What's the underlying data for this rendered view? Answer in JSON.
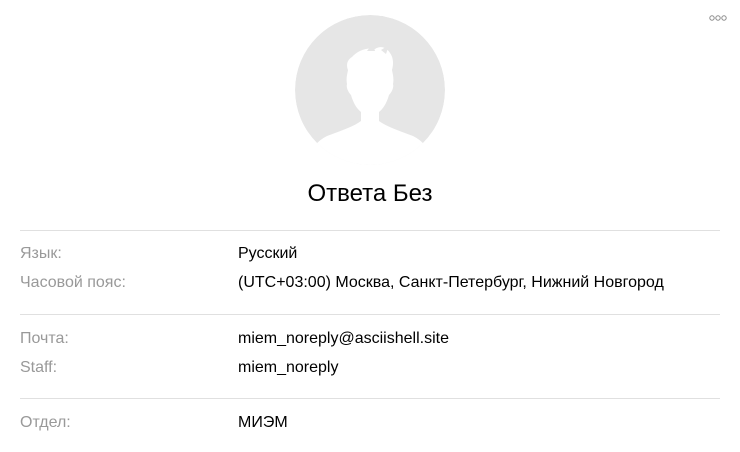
{
  "header": {
    "more_icon": "ellipsis-horizontal-icon"
  },
  "avatar": {
    "icon": "user-silhouette-icon",
    "background_color": "#e6e6e6",
    "silhouette_color": "#ffffff"
  },
  "profile": {
    "name": "Ответа Без"
  },
  "sections": {
    "locale": {
      "language_label": "Язык:",
      "language_value": "Русский",
      "timezone_label": "Часовой пояс:",
      "timezone_value": "(UTC+03:00) Москва, Санкт-Петербург, Нижний Новгород"
    },
    "contacts": {
      "email_label": "Почта:",
      "email_value": "miem_noreply@asciishell.site",
      "staff_label": "Staff:",
      "staff_value": "miem_noreply"
    },
    "department": {
      "department_label": "Отдел:",
      "department_value": "МИЭМ"
    }
  },
  "colors": {
    "label_text": "#999999",
    "value_text": "#000000",
    "divider": "#e0e0e0",
    "more_icon": "#8c8c8c"
  }
}
